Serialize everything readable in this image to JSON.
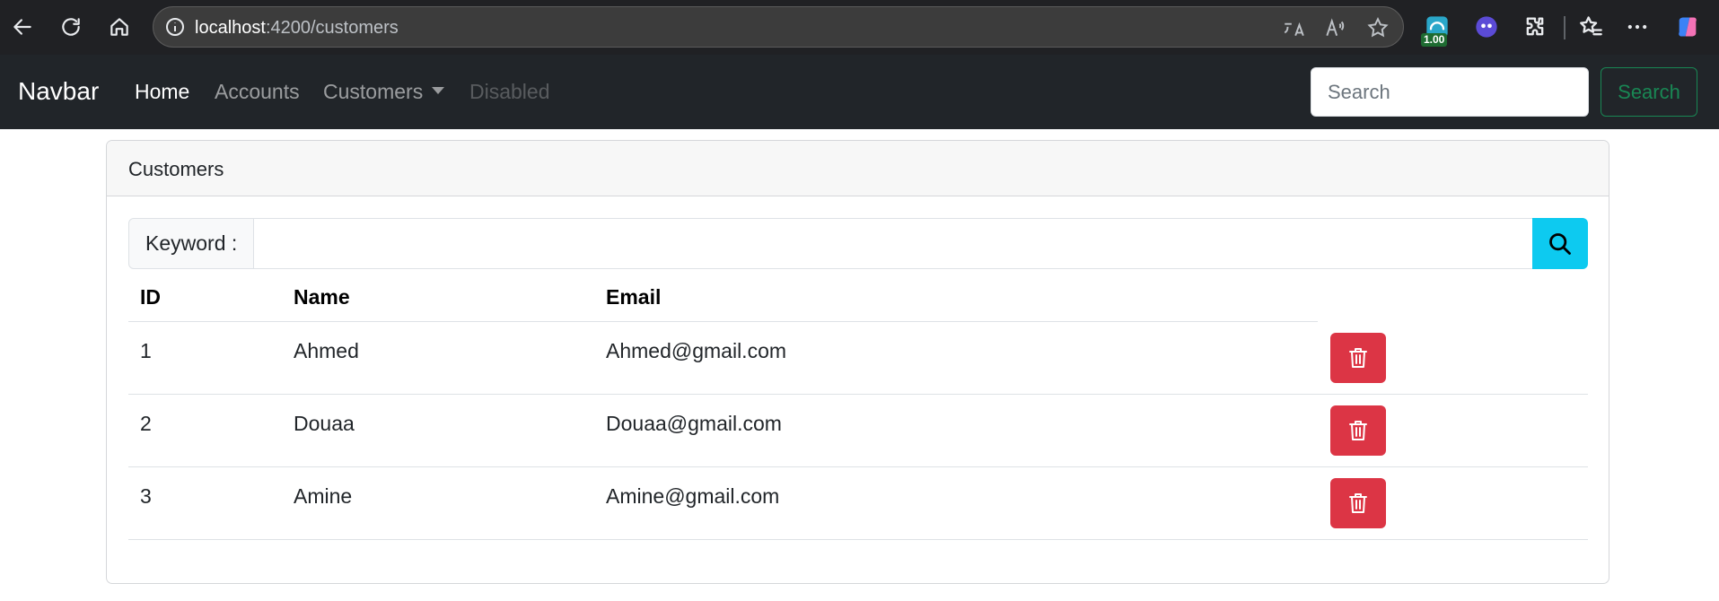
{
  "browser": {
    "url_host": "localhost",
    "url_path": ":4200/customers",
    "extension_badge": "1.00"
  },
  "navbar": {
    "brand": "Navbar",
    "links": [
      {
        "label": "Home"
      },
      {
        "label": "Accounts"
      },
      {
        "label": "Customers"
      },
      {
        "label": "Disabled"
      }
    ],
    "search_placeholder": "Search",
    "search_button": "Search"
  },
  "card": {
    "title": "Customers",
    "keyword_label": "Keyword :",
    "keyword_value": "",
    "columns": [
      "ID",
      "Name",
      "Email"
    ],
    "rows": [
      {
        "id": "1",
        "name": "Ahmed",
        "email": "Ahmed@gmail.com"
      },
      {
        "id": "2",
        "name": "Douaa",
        "email": "Douaa@gmail.com"
      },
      {
        "id": "3",
        "name": "Amine",
        "email": "Amine@gmail.com"
      }
    ]
  },
  "colors": {
    "navbar_bg": "#212529",
    "success": "#198754",
    "info": "#0dcaf0",
    "danger": "#dc3545"
  }
}
